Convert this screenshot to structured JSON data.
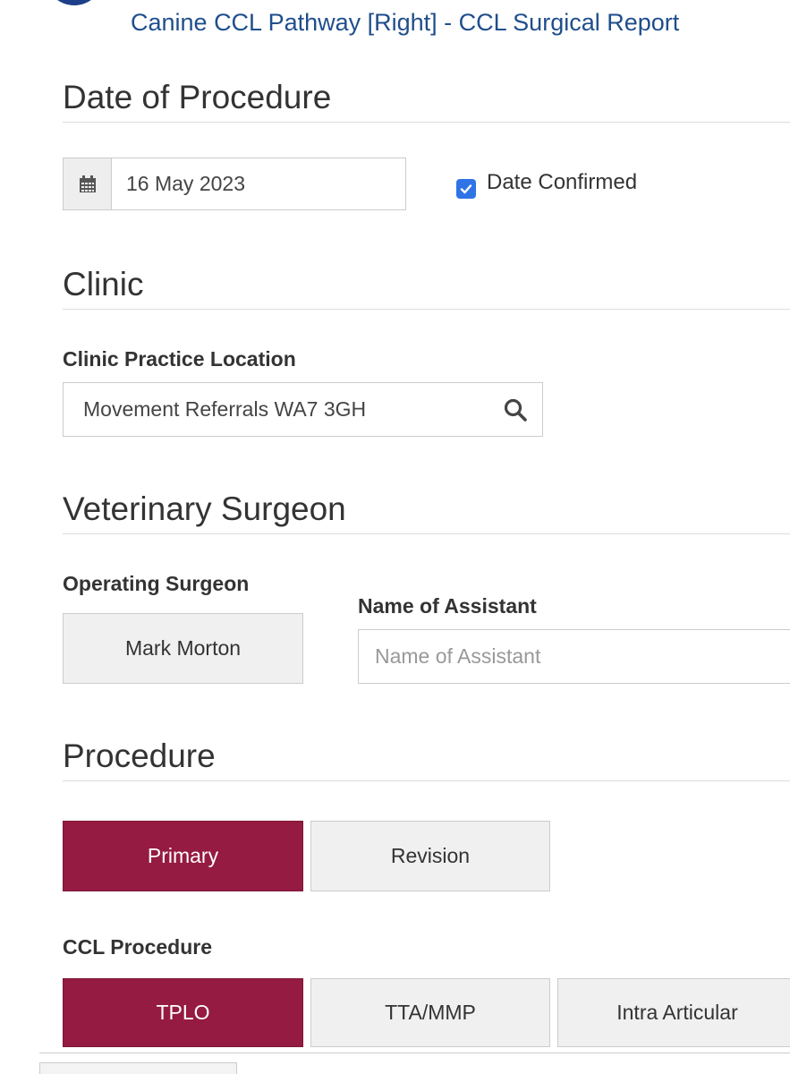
{
  "header": {
    "title": "Canine CCL Pathway [Right] - CCL Surgical Report"
  },
  "date_section": {
    "title": "Date of Procedure",
    "date_value": "16 May 2023",
    "confirmed_label": "Date Confirmed",
    "confirmed_checked": true
  },
  "clinic_section": {
    "title": "Clinic",
    "location_label": "Clinic Practice Location",
    "location_value": "Movement Referrals WA7 3GH"
  },
  "surgeon_section": {
    "title": "Veterinary Surgeon",
    "operating_label": "Operating Surgeon",
    "operating_value": "Mark Morton",
    "assistant_label": "Name of Assistant",
    "assistant_placeholder": "Name of Assistant"
  },
  "procedure_section": {
    "title": "Procedure",
    "types": [
      {
        "label": "Primary",
        "active": true
      },
      {
        "label": "Revision",
        "active": false
      }
    ],
    "ccl_label": "CCL Procedure",
    "ccl_options": [
      {
        "label": "TPLO",
        "active": true
      },
      {
        "label": "TTA/MMP",
        "active": false
      },
      {
        "label": "Intra Articular",
        "active": false
      }
    ]
  },
  "colors": {
    "accent_active": "#951b42",
    "header_blue": "#1f4e8c",
    "checkbox_blue": "#2f74e6"
  }
}
